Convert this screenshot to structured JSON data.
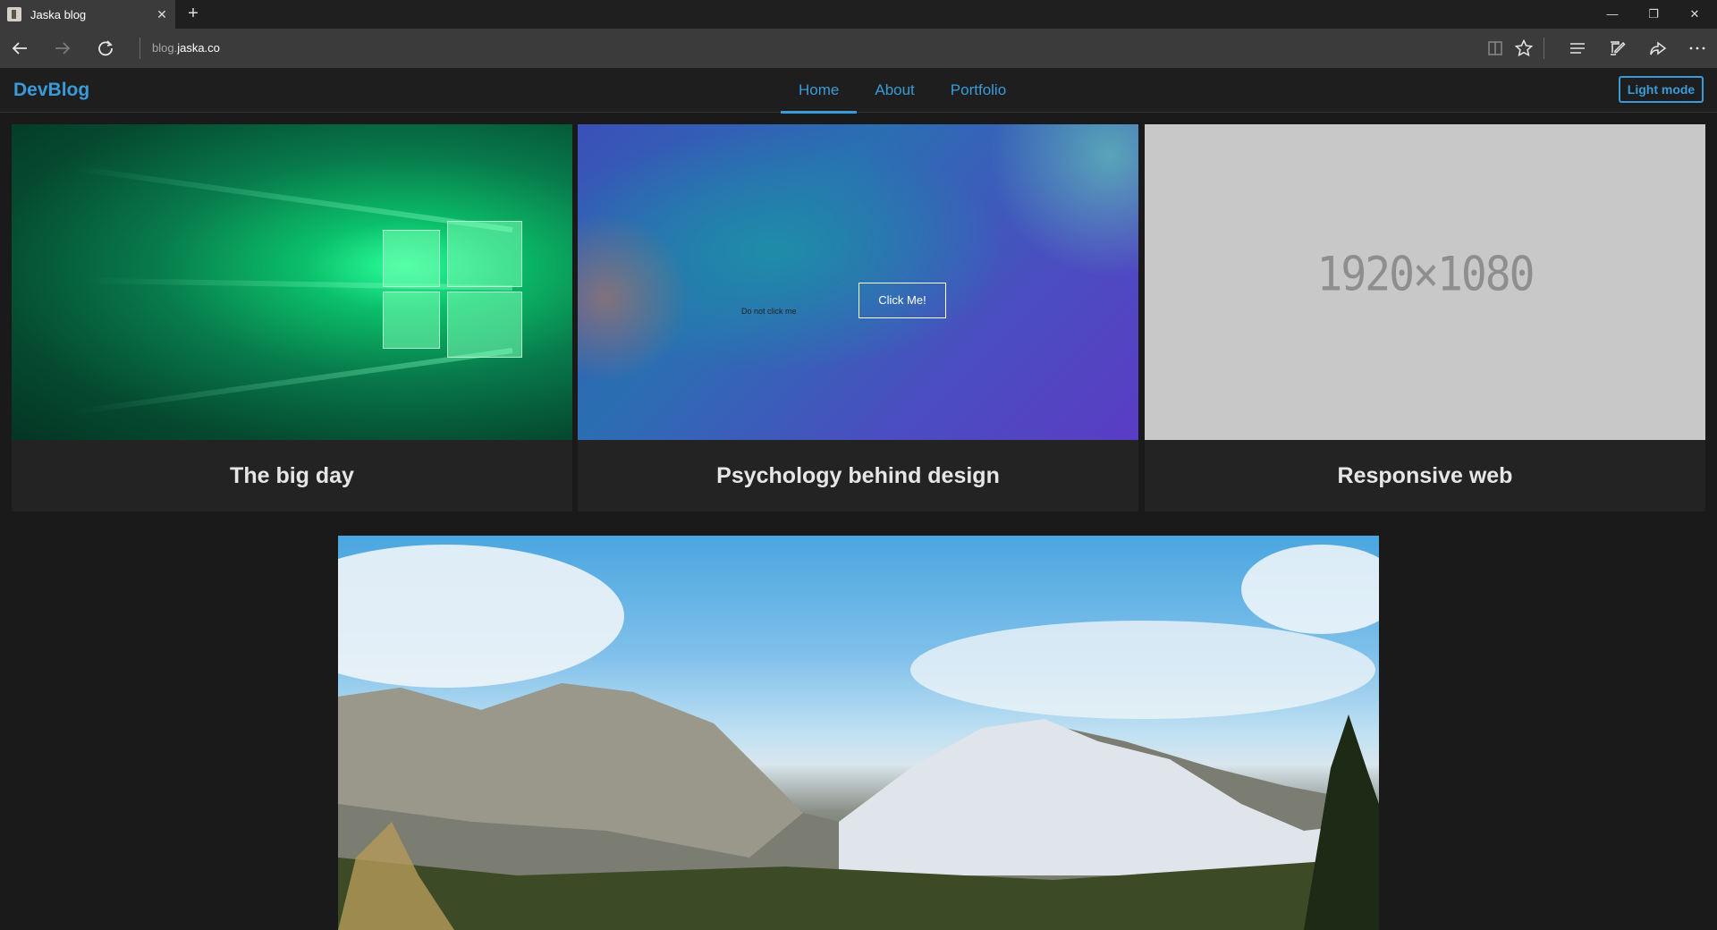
{
  "browser": {
    "tab_title": "Jaska blog",
    "tab_close": "✕",
    "new_tab": "+",
    "url_prefix": "blog.",
    "url_domain": "jaska.co",
    "window_controls": {
      "minimize": "—",
      "restore": "❐",
      "close": "✕"
    }
  },
  "site": {
    "brand": "DevBlog",
    "nav": [
      {
        "label": "Home",
        "active": true
      },
      {
        "label": "About",
        "active": false
      },
      {
        "label": "Portfolio",
        "active": false
      }
    ],
    "mode_button": "Light mode",
    "accent_color": "#3a9bd9"
  },
  "posts": [
    {
      "title": "The big day",
      "image": "windows-logo-light"
    },
    {
      "title": "Psychology behind design",
      "image": "gradient-with-buttons",
      "link_text": "Do not click me",
      "button_text": "Click Me!"
    },
    {
      "title": "Responsive web",
      "image": "placeholder",
      "placeholder_text": "1920×1080"
    }
  ],
  "hero": {
    "image": "mountain-landscape"
  }
}
